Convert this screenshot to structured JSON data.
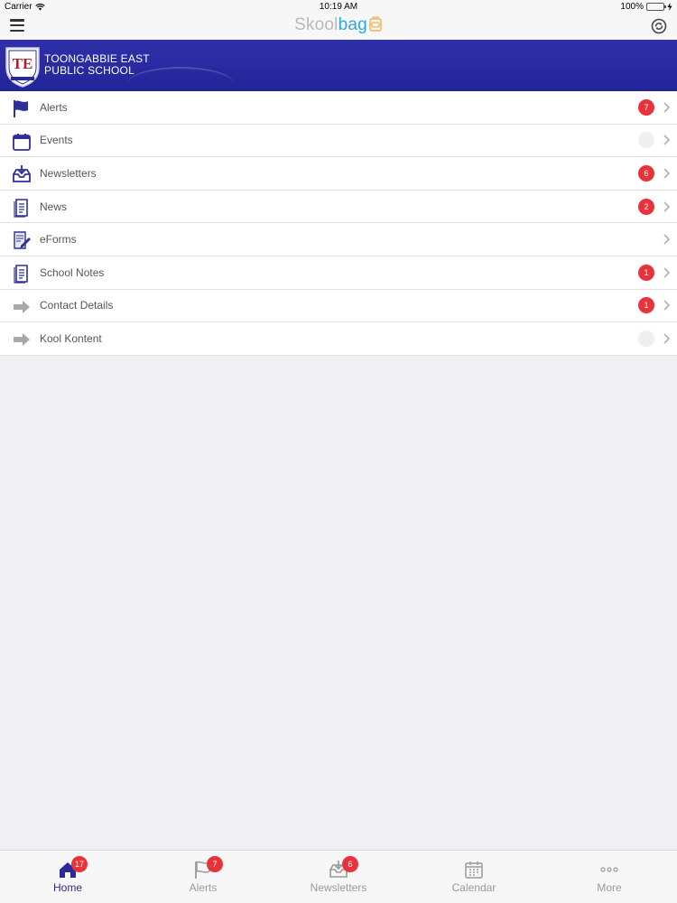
{
  "status_bar": {
    "carrier": "Carrier",
    "time": "10:19 AM",
    "battery_text": "100%",
    "battery_level": 1.0
  },
  "nav": {
    "brand_part1": "Skool",
    "brand_part2": "bag"
  },
  "school": {
    "name_line1": "TOONGABBIE EAST",
    "name_line2": "PUBLIC SCHOOL",
    "crest_monogram": "TE"
  },
  "menu": [
    {
      "label": "Alerts",
      "icon": "flag-icon",
      "badge": "7",
      "badge_style": "red"
    },
    {
      "label": "Events",
      "icon": "calendar-icon",
      "badge": "",
      "badge_style": "empty"
    },
    {
      "label": "Newsletters",
      "icon": "inbox-download-icon",
      "badge": "6",
      "badge_style": "red"
    },
    {
      "label": "News",
      "icon": "document-icon",
      "badge": "2",
      "badge_style": "red"
    },
    {
      "label": "eForms",
      "icon": "form-pen-icon",
      "badge": "",
      "badge_style": "none"
    },
    {
      "label": "School Notes",
      "icon": "document-icon",
      "badge": "1",
      "badge_style": "red"
    },
    {
      "label": "Contact Details",
      "icon": "arrow-right-icon",
      "badge": "1",
      "badge_style": "red"
    },
    {
      "label": "Kool Kontent",
      "icon": "arrow-right-icon",
      "badge": "",
      "badge_style": "empty"
    }
  ],
  "tabs": [
    {
      "label": "Home",
      "icon": "home-icon",
      "badge": "17",
      "active": true
    },
    {
      "label": "Alerts",
      "icon": "flag-icon",
      "badge": "7",
      "active": false
    },
    {
      "label": "Newsletters",
      "icon": "inbox-download-icon",
      "badge": "6",
      "active": false
    },
    {
      "label": "Calendar",
      "icon": "calendar-icon",
      "badge": "",
      "active": false
    },
    {
      "label": "More",
      "icon": "more-dots-icon",
      "badge": "",
      "active": false
    }
  ],
  "colors": {
    "banner": "#2a2aa0",
    "icon_blue": "#2f2f9c",
    "badge_red": "#e8333a",
    "brand_gray": "#b9b9b9",
    "brand_blue": "#2ea7e0"
  }
}
